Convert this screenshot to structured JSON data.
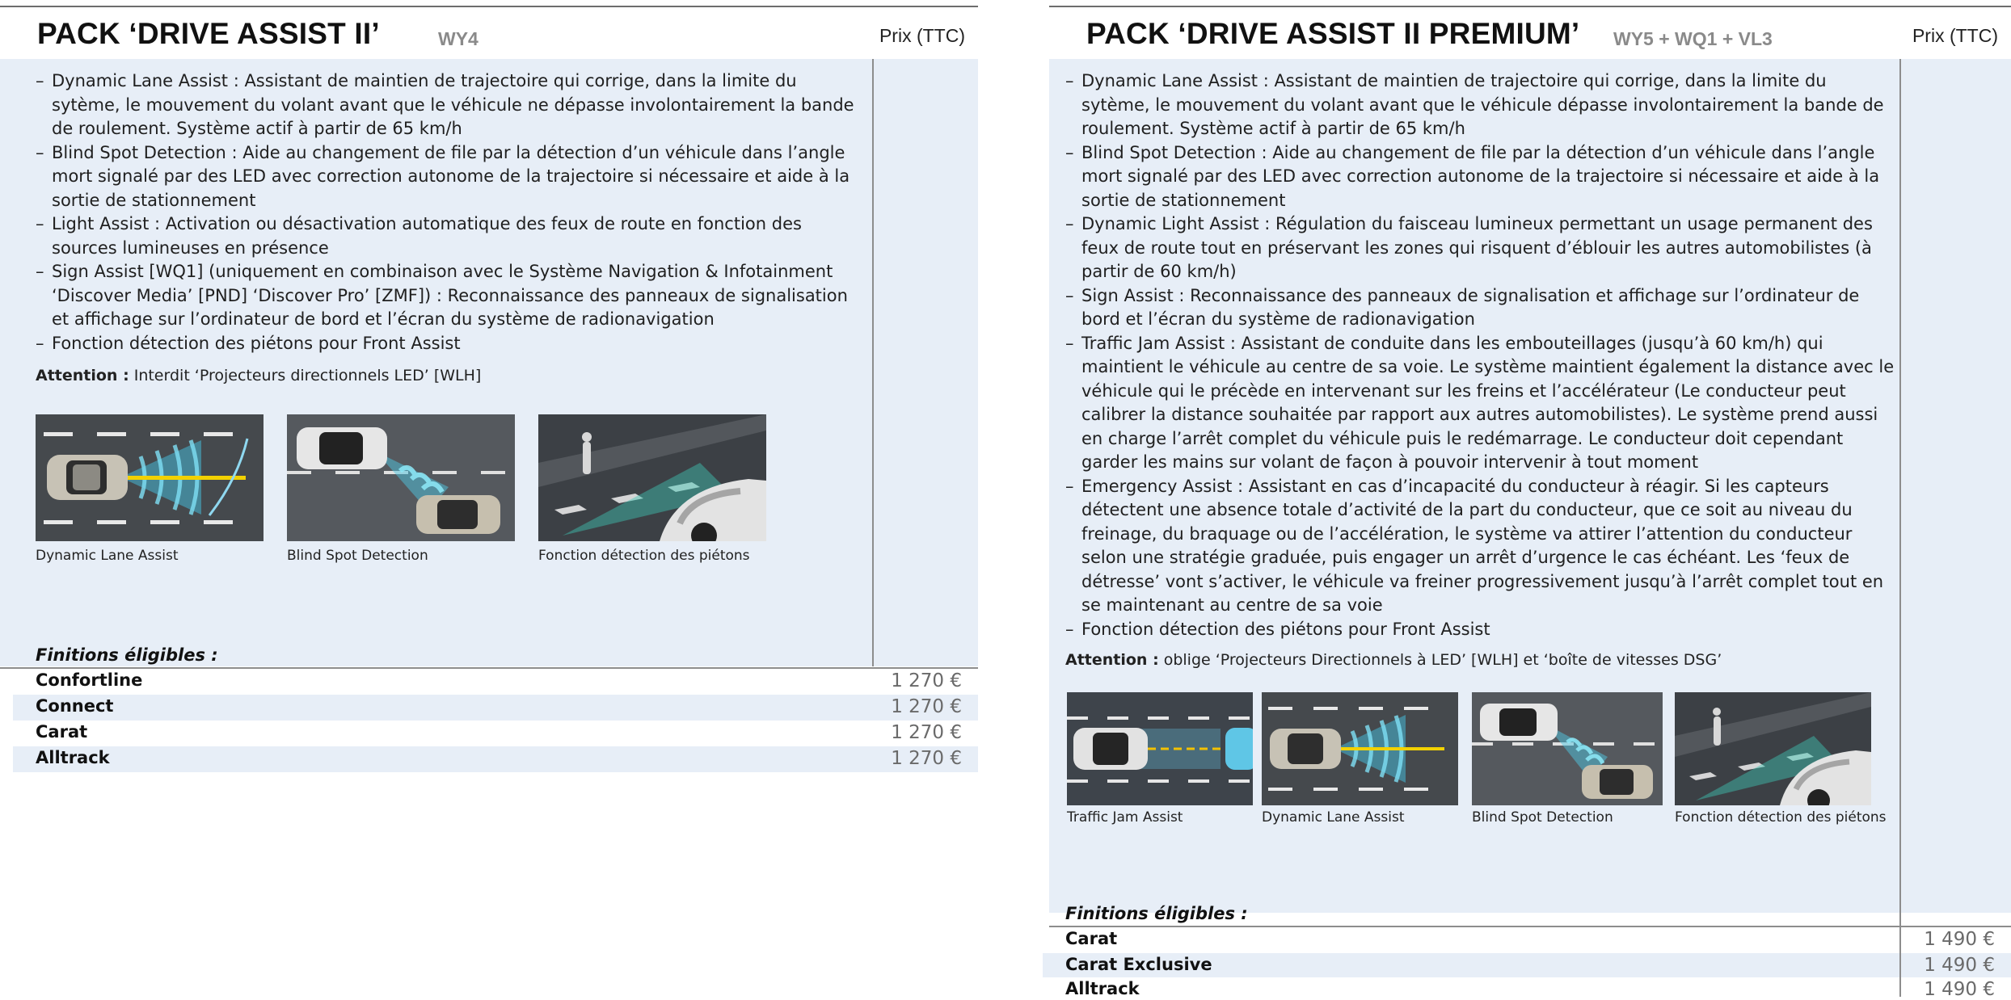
{
  "left": {
    "title": "PACK ‘DRIVE ASSIST II’",
    "code": "WY4",
    "price_header": "Prix (TTC)",
    "features": [
      "Dynamic Lane Assist : Assistant de maintien de trajectoire qui corrige, dans la limite du sytème, le mouvement du volant avant que le véhicule ne dépasse involontairement la bande de roulement. Système actif à partir de 65 km/h",
      "Blind Spot Detection : Aide au changement de file par la détection d’un véhicule dans l’angle mort signalé par des LED avec correction autonome de la trajectoire si nécessaire et aide à la sortie de stationnement",
      "Light Assist : Activation ou désactivation automatique des feux de route en fonction des sources lumineuses en présence",
      "Sign Assist [WQ1] (uniquement en combinaison avec le Système Navigation & Infotainment ‘Discover Media’ [PND] ‘Discover Pro’ [ZMF]) : Reconnaissance des panneaux de signalisation et affichage sur l’ordinateur de bord et l’écran du système de radionavigation",
      "Fonction détection des piétons pour Front Assist"
    ],
    "attention_label": "Attention :",
    "attention_text": " Interdit ‘Projecteurs directionnels LED’ [WLH]",
    "captions": [
      "Dynamic Lane Assist",
      "Blind Spot Detection",
      "Fonction détection des piétons"
    ],
    "eligible_label": "Finitions éligibles :",
    "rows": [
      {
        "name": "Confortline",
        "price": "1 270 €"
      },
      {
        "name": "Connect",
        "price": "1 270 €"
      },
      {
        "name": "Carat",
        "price": "1 270 €"
      },
      {
        "name": "Alltrack",
        "price": "1 270 €"
      }
    ]
  },
  "right": {
    "title": "PACK ‘DRIVE ASSIST II PREMIUM’",
    "code": "WY5 + WQ1 + VL3",
    "price_header": "Prix (TTC)",
    "features": [
      "Dynamic Lane Assist : Assistant de maintien de trajectoire qui corrige, dans la limite du sytème, le mouvement du volant avant que le véhicule dépasse involontairement la bande de roulement. Système actif à partir de 65 km/h",
      "Blind Spot Detection : Aide au changement de file par la détection d’un véhicule dans l’angle mort signalé par des LED avec correction autonome de la trajectoire si nécessaire et aide à la sortie de stationnement",
      "Dynamic Light Assist : Régulation du faisceau lumineux permettant un usage permanent des feux de route tout en préservant les zones qui risquent d’éblouir les autres automobilistes (à partir de 60 km/h)",
      "Sign Assist : Reconnaissance des panneaux de signalisation et affichage sur l’ordinateur de bord et l’écran du système de radionavigation",
      "Traffic Jam Assist : Assistant de conduite dans les embouteillages (jusqu’à 60 km/h) qui maintient le véhicule au centre de sa voie. Le système maintient également la distance avec le véhicule qui le précède en intervenant sur les freins et l’accélérateur (Le conducteur peut calibrer la distance souhaitée par rapport aux autres automobilistes). Le système prend aussi en charge l’arrêt complet du véhicule puis le redémarrage. Le conducteur doit cependant garder les mains sur volant de façon à pouvoir intervenir à tout moment",
      "Emergency Assist : Assistant en cas d’incapacité du conducteur à réagir. Si les capteurs détectent une absence totale d’activité de la part du conducteur, que ce soit au niveau du freinage, du braquage ou de l’accélération, le système va attirer l’attention du conducteur selon une stratégie graduée, puis engager un arrêt d’urgence le cas échéant. Les ‘feux de détresse’ vont s’activer, le véhicule va freiner progressivement jusqu’à l’arrêt complet tout en se maintenant au centre de sa voie",
      "Fonction détection des piétons pour Front Assist"
    ],
    "attention_label": "Attention :",
    "attention_text": " oblige ‘Projecteurs Directionnels à LED’ [WLH] et ‘boîte de vitesses DSG’",
    "captions": [
      "Traffic Jam Assist",
      "Dynamic Lane Assist",
      "Blind Spot Detection",
      "Fonction détection des piétons"
    ],
    "eligible_label": "Finitions éligibles :",
    "rows": [
      {
        "name": "Carat",
        "price": "1 490 €"
      },
      {
        "name": "Carat Exclusive",
        "price": "1 490 €"
      },
      {
        "name": "Alltrack",
        "price": "1 490 €"
      }
    ]
  }
}
